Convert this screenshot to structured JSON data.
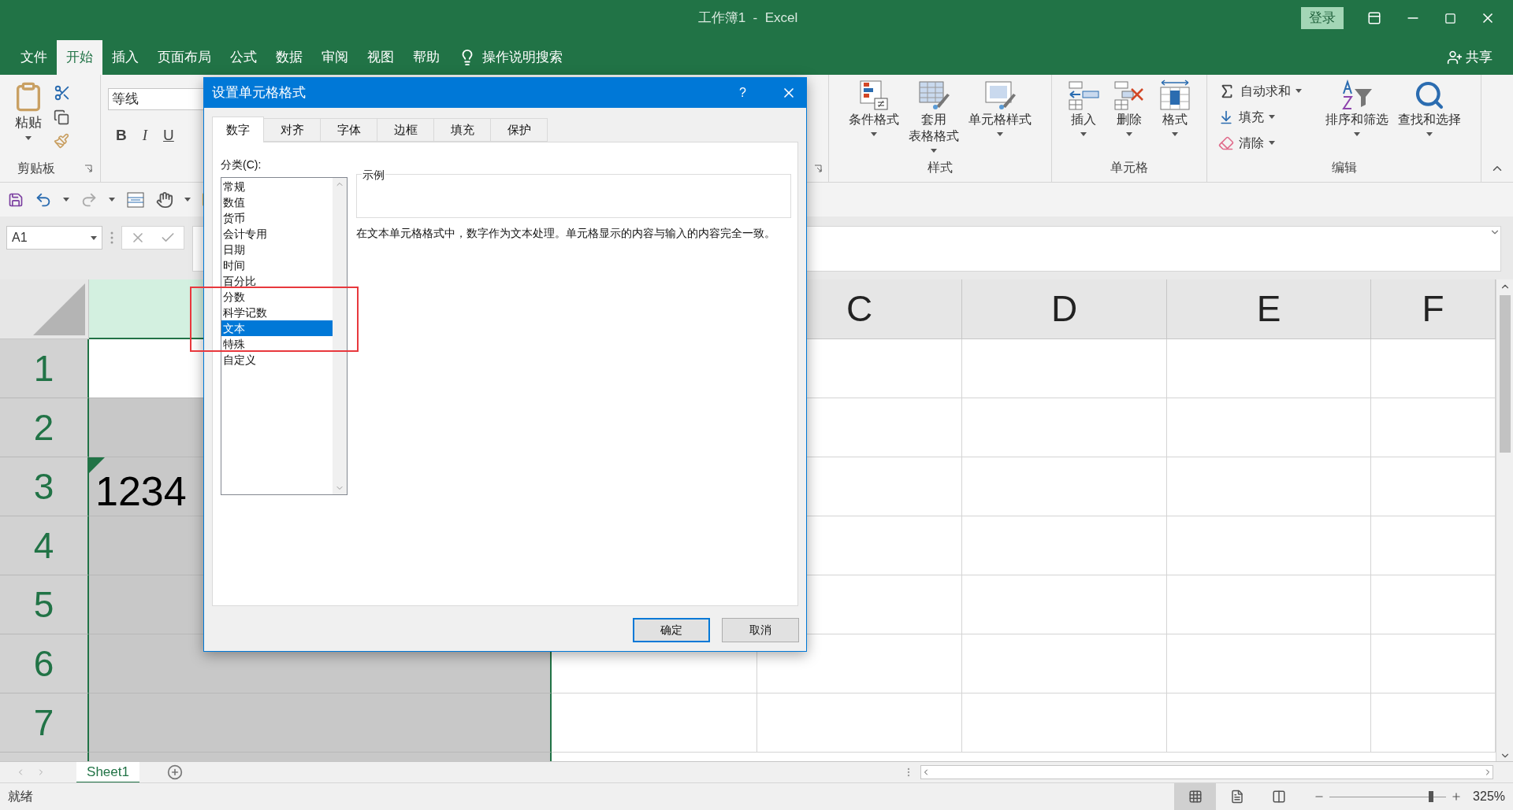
{
  "window": {
    "title": "工作簿1  -  Excel",
    "login_button": "登录",
    "share_button": "共享"
  },
  "menu_tabs": [
    {
      "label": "文件",
      "selected": false
    },
    {
      "label": "开始",
      "selected": true
    },
    {
      "label": "插入",
      "selected": false
    },
    {
      "label": "页面布局",
      "selected": false
    },
    {
      "label": "公式",
      "selected": false
    },
    {
      "label": "数据",
      "selected": false
    },
    {
      "label": "审阅",
      "selected": false
    },
    {
      "label": "视图",
      "selected": false
    },
    {
      "label": "帮助",
      "selected": false
    }
  ],
  "tell_me": "操作说明搜索",
  "ribbon": {
    "clipboard": {
      "paste": "粘贴",
      "group_label": "剪贴板"
    },
    "font": {
      "font_name": "等线",
      "bold": "B",
      "italic": "I",
      "underline": "U"
    },
    "styles": {
      "buttons": [
        {
          "kind": "conditional",
          "lines": [
            "条件格式"
          ]
        },
        {
          "kind": "table",
          "lines": [
            "套用",
            "表格格式"
          ]
        },
        {
          "kind": "cellstyle",
          "lines": [
            "单元格样式"
          ]
        }
      ],
      "group_label": "样式"
    },
    "cells": {
      "buttons": [
        {
          "kind": "insert",
          "lines": [
            "插入"
          ]
        },
        {
          "kind": "delete",
          "lines": [
            "删除"
          ]
        },
        {
          "kind": "format",
          "lines": [
            "格式"
          ]
        }
      ],
      "group_label": "单元格"
    },
    "editing": {
      "small_buttons": [
        {
          "kind": "sum",
          "label": "自动求和"
        },
        {
          "kind": "fill",
          "label": "填充"
        },
        {
          "kind": "clear",
          "label": "清除"
        }
      ],
      "big_buttons": [
        {
          "kind": "sort",
          "lines": [
            "排序和筛选"
          ]
        },
        {
          "kind": "find",
          "lines": [
            "查找和选择"
          ]
        }
      ],
      "group_label": "编辑"
    }
  },
  "formula_bar": {
    "name_box": "A1"
  },
  "sheet": {
    "columns": [
      {
        "selected": true
      },
      {
        "label": "C",
        "selected": false
      },
      {
        "label": "D",
        "selected": false
      },
      {
        "label": "E",
        "selected": false
      },
      {
        "label": "F",
        "selected": false
      }
    ],
    "rows": [
      {
        "label": "1",
        "selected": true,
        "active": true
      },
      {
        "label": "2",
        "selected": true,
        "active": false
      },
      {
        "label": "3",
        "selected": true,
        "active": false,
        "cell": "1234",
        "text_warning": true
      },
      {
        "label": "4",
        "selected": true,
        "active": false
      },
      {
        "label": "5",
        "selected": true,
        "active": false
      },
      {
        "label": "6",
        "selected": true,
        "active": false
      },
      {
        "label": "7",
        "selected": true,
        "active": false
      }
    ]
  },
  "sheet_tabs": [
    {
      "label": "Sheet1",
      "selected": true
    }
  ],
  "status_bar": {
    "status": "就绪",
    "zoom": "325%",
    "level": 0.87,
    "views": [
      {
        "kind": "normal",
        "selected": true
      },
      {
        "kind": "page_layout",
        "selected": false
      },
      {
        "kind": "page_break",
        "selected": false
      }
    ]
  },
  "dialog": {
    "title": "设置单元格格式",
    "help": "?",
    "tabs": [
      {
        "label": "数字",
        "selected": true
      },
      {
        "label": "对齐",
        "selected": false
      },
      {
        "label": "字体",
        "selected": false
      },
      {
        "label": "边框",
        "selected": false
      },
      {
        "label": "填充",
        "selected": false
      },
      {
        "label": "保护",
        "selected": false
      }
    ],
    "category_label": "分类(C):",
    "categories": [
      {
        "label": "常规",
        "selected": false
      },
      {
        "label": "数值",
        "selected": false
      },
      {
        "label": "货币",
        "selected": false
      },
      {
        "label": "会计专用",
        "selected": false
      },
      {
        "label": "日期",
        "selected": false
      },
      {
        "label": "时间",
        "selected": false
      },
      {
        "label": "百分比",
        "selected": false
      },
      {
        "label": "分数",
        "selected": false
      },
      {
        "label": "科学记数",
        "selected": false
      },
      {
        "label": "文本",
        "selected": true
      },
      {
        "label": "特殊",
        "selected": false
      },
      {
        "label": "自定义",
        "selected": false
      }
    ],
    "sample_label": "示例",
    "description": "在文本单元格格式中，数字作为文本处理。单元格显示的内容与输入的内容完全一致。",
    "buttons": [
      {
        "label": "确定",
        "kind": "default"
      },
      {
        "label": "取消",
        "kind": "normal"
      }
    ]
  }
}
